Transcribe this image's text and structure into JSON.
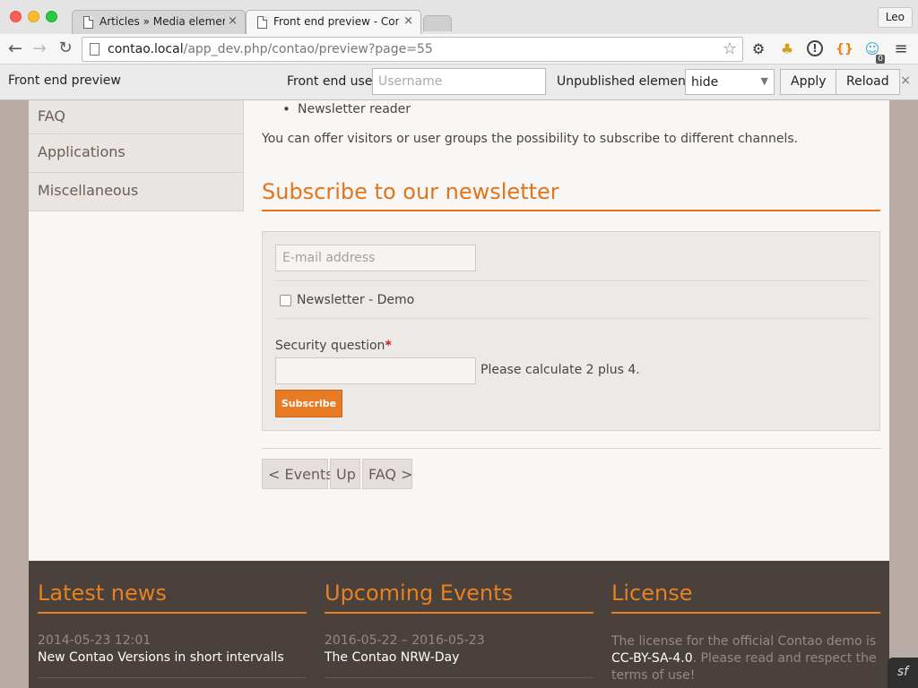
{
  "browser": {
    "tabs": [
      {
        "label": "Articles » Media elements",
        "active": false
      },
      {
        "label": "Front end preview - Contao",
        "active": true
      }
    ],
    "user_chip": "Leo",
    "url_host": "contao.local",
    "url_path": "/app_dev.php/contao/preview?page=55",
    "extension_badge": "0"
  },
  "preview_bar": {
    "title": "Front end preview",
    "user_label": "Front end user:",
    "user_placeholder": "Username",
    "unpublished_label": "Unpublished elements:",
    "unpublished_value": "hide",
    "apply_label": "Apply",
    "reload_label": "Reload",
    "close_label": "×"
  },
  "sidebar": {
    "items": [
      {
        "label": "FAQ"
      },
      {
        "label": "Applications"
      },
      {
        "label": "Miscellaneous"
      }
    ]
  },
  "main": {
    "bullet": "Newsletter reader",
    "intro": "You can offer visitors or user groups the possibility to subscribe to different channels.",
    "heading": "Subscribe to our newsletter",
    "email_placeholder": "E-mail address",
    "channel_label": "Newsletter - Demo",
    "security_label": "Security question",
    "security_required": "*",
    "security_hint": "Please calculate 2 plus 4.",
    "subscribe_label": "Subscribe",
    "pager": {
      "prev": "< Events",
      "up": "Up",
      "next": "FAQ >"
    }
  },
  "footer": {
    "news": {
      "heading": "Latest news",
      "date": "2014-05-23 12:01",
      "title": "New Contao Versions in short intervalls"
    },
    "events": {
      "heading": "Upcoming Events",
      "date": "2016-05-22 – 2016-05-23",
      "title": "The Contao NRW-Day"
    },
    "license": {
      "heading": "License",
      "text_pre": "The license for the official Contao demo is ",
      "link": "CC-BY-SA-4.0",
      "text_post": ". Please read and respect the terms of use!"
    }
  },
  "symfony_badge": "sf",
  "colors": {
    "accent": "#e2741a",
    "footer_bg": "#4a413c",
    "page_bg": "#f8f7f6"
  }
}
